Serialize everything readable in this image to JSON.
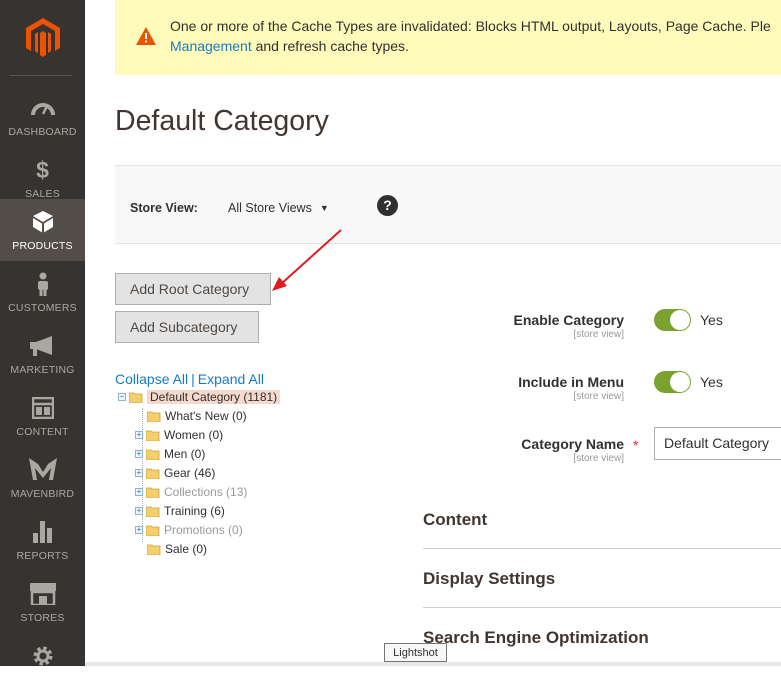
{
  "notice": {
    "line1": "One or more of the Cache Types are invalidated: Blocks HTML output, Layouts, Page Cache. Ple",
    "link": "Management",
    "line2_rest": " and refresh cache types."
  },
  "nav": [
    {
      "label": "DASHBOARD",
      "icon": "dashboard-icon"
    },
    {
      "label": "SALES",
      "icon": "dollar-icon"
    },
    {
      "label": "PRODUCTS",
      "icon": "box-icon"
    },
    {
      "label": "CUSTOMERS",
      "icon": "person-icon"
    },
    {
      "label": "MARKETING",
      "icon": "megaphone-icon"
    },
    {
      "label": "CONTENT",
      "icon": "layout-icon"
    },
    {
      "label": "MAVENBIRD",
      "icon": "mavenbird-icon"
    },
    {
      "label": "REPORTS",
      "icon": "bar-chart-icon"
    },
    {
      "label": "STORES",
      "icon": "store-icon"
    }
  ],
  "page_title": "Default Category",
  "store_view": {
    "label": "Store View:",
    "value": "All Store Views",
    "help": "?"
  },
  "buttons": {
    "add_root": "Add Root Category",
    "add_sub": "Add Subcategory"
  },
  "tree_links": {
    "collapse": "Collapse All",
    "sep": "|",
    "expand": "Expand All"
  },
  "tree": [
    {
      "label": "Default Category (1181)"
    },
    {
      "label": "What's New (0)"
    },
    {
      "label": "Women (0)"
    },
    {
      "label": "Men (0)"
    },
    {
      "label": "Gear (46)"
    },
    {
      "label": "Collections (13)"
    },
    {
      "label": "Training (6)"
    },
    {
      "label": "Promotions (0)"
    },
    {
      "label": "Sale (0)"
    }
  ],
  "form": {
    "enable_label": "Enable Category",
    "enable_scope": "[store view]",
    "enable_value": "Yes",
    "menu_label": "Include in Menu",
    "menu_scope": "[store view]",
    "menu_value": "Yes",
    "name_label": "Category Name",
    "name_scope": "[store view]",
    "name_value": "Default Category",
    "required_mark": "*"
  },
  "sections": {
    "content": "Content",
    "display": "Display Settings",
    "seo": "Search Engine Optimization"
  },
  "tooltip": "Lightshot",
  "colors": {
    "sidebar": "#373330",
    "accent_orange": "#eb5202",
    "toggle_on": "#79a22e",
    "link": "#1979c3",
    "notice_bg": "#fffbbb"
  }
}
